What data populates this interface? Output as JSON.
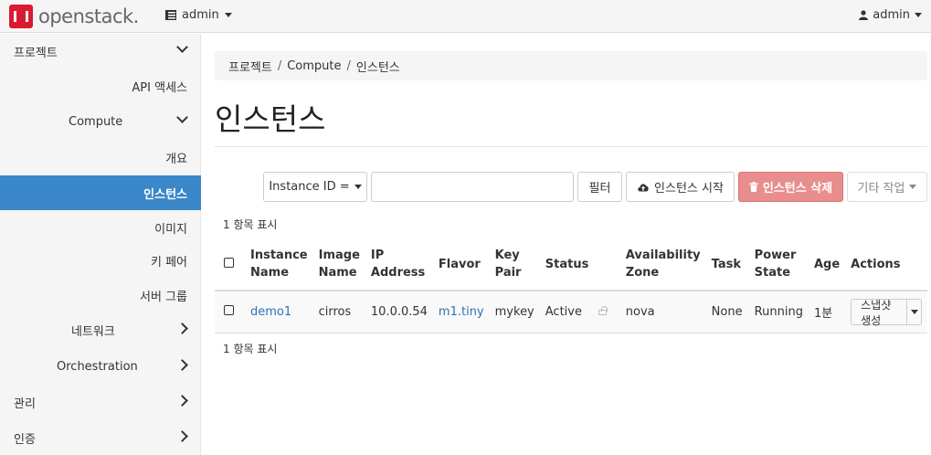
{
  "brand": "openstack.",
  "topbar": {
    "project": "admin",
    "user": "admin"
  },
  "sidebar": {
    "items": [
      {
        "label": "프로젝트"
      },
      {
        "label": "API 액세스"
      },
      {
        "label": "Compute"
      },
      {
        "label": "개요"
      },
      {
        "label": "인스턴스"
      },
      {
        "label": "이미지"
      },
      {
        "label": "키 페어"
      },
      {
        "label": "서버 그룹"
      },
      {
        "label": "네트워크"
      },
      {
        "label": "Orchestration"
      },
      {
        "label": "관리"
      },
      {
        "label": "인증"
      }
    ]
  },
  "breadcrumb": {
    "item1": "프로젝트",
    "item2": "Compute",
    "item3": "인스턴스",
    "sep": "/"
  },
  "page_title": "인스턴스",
  "toolbar": {
    "filter_field": "Instance ID =",
    "filter_value": "",
    "filter_button": "필터",
    "launch_button": "인스턴스 시작",
    "delete_button": "인스턴스 삭제",
    "more_button": "기타 작업"
  },
  "count_text": "1 항목 표시",
  "table": {
    "headers": [
      [
        "Instance",
        "Name"
      ],
      [
        "Image",
        "Name"
      ],
      [
        "IP",
        "Address"
      ],
      [
        "Flavor"
      ],
      [
        "Key",
        "Pair"
      ],
      [
        "Status"
      ],
      [
        "Availability",
        "Zone"
      ],
      [
        "Task"
      ],
      [
        "Power",
        "State"
      ],
      [
        "Age"
      ],
      [
        "Actions"
      ]
    ],
    "rows": [
      {
        "name": "demo1",
        "image": "cirros",
        "ip": "10.0.0.54",
        "flavor": "m1.tiny",
        "key": "mykey",
        "status": "Active",
        "zone": "nova",
        "task": "None",
        "power": "Running",
        "age": "1분",
        "action": "스냅샷 생성"
      }
    ]
  },
  "colors": {
    "accent": "#3a87c9",
    "danger": "#e88e8e",
    "brand": "#da1a32",
    "link": "#2a72b5"
  }
}
